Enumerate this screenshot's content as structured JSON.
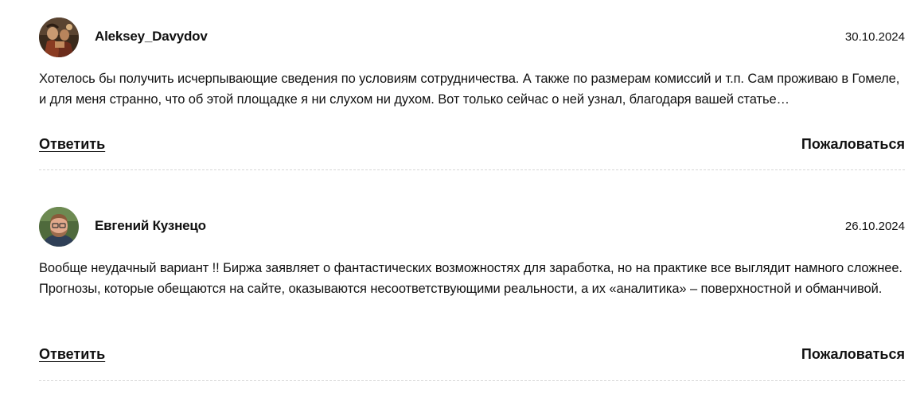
{
  "comments": [
    {
      "author": "Aleksey_Davydov",
      "date": "30.10.2024",
      "text": "Хотелось бы получить исчерпывающие сведения по условиям сотрудничества. А также по размерам комиссий и т.п. Сам проживаю в Гомеле, и для меня странно, что об этой площадке я ни слухом ни духом. Вот только сейчас о ней узнал, благодаря вашей статье…",
      "reply_label": "Ответить",
      "report_label": "Пожаловаться",
      "avatar_icon": "painting-portrait-avatar"
    },
    {
      "author": "Евгений Кузнецо",
      "date": "26.10.2024",
      "text": "Вообще неудачный вариант !! Биржа заявляет о фантастических возможностях для заработка, но на практике все выглядит намного сложнее. Прогнозы, которые обещаются на сайте, оказываются несоответствующими реальности, а их «аналитика» – поверхностной и обманчивой.",
      "reply_label": "Ответить",
      "report_label": "Пожаловаться",
      "avatar_icon": "man-photo-avatar"
    }
  ],
  "colors": {
    "text": "#111111",
    "divider": "#d6d6d6",
    "background": "#ffffff"
  }
}
